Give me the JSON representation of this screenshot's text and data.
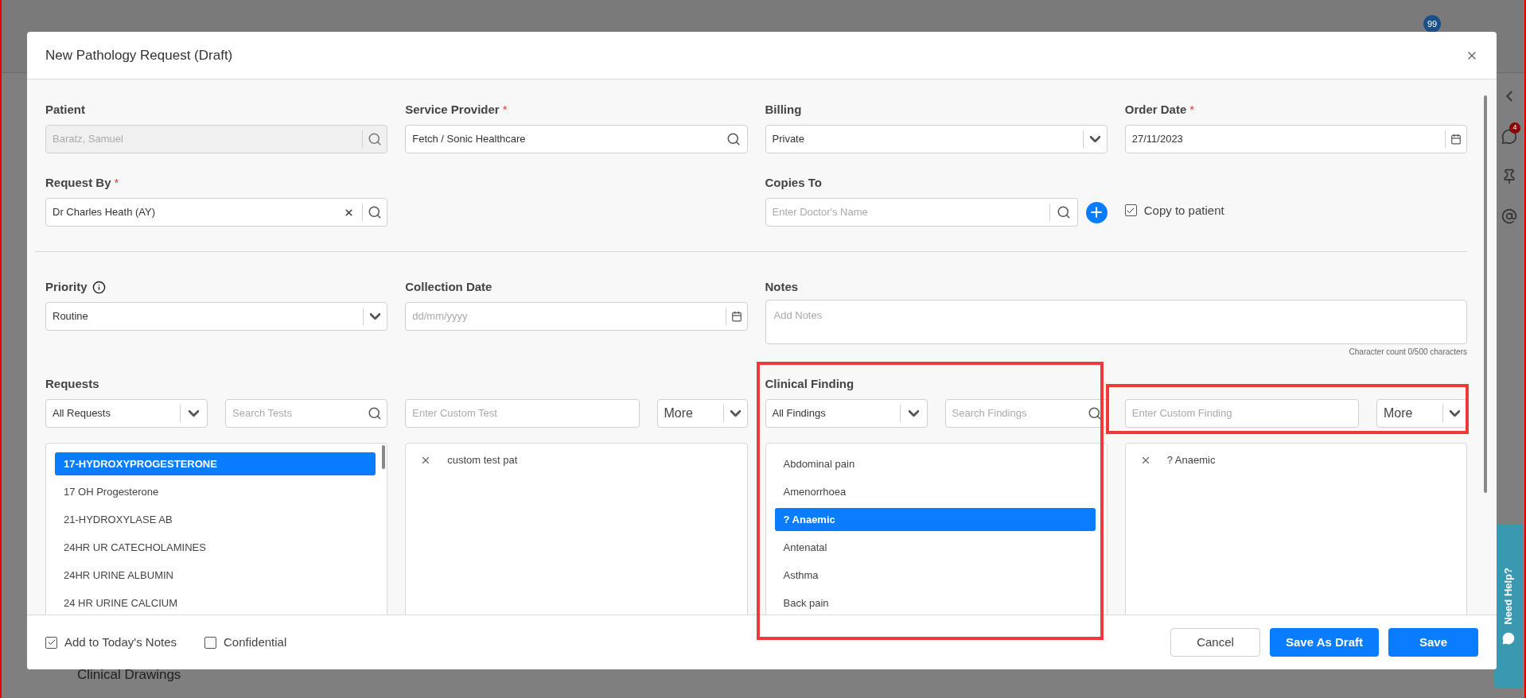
{
  "background": {
    "notification_count": "99",
    "chat_count": "4",
    "sidebar_item": "Clinical Drawings",
    "help_tab": "Need Help?"
  },
  "modal": {
    "title": "New Pathology Request (Draft)"
  },
  "patient": {
    "label": "Patient",
    "value": "Baratz, Samuel",
    "disabled": true
  },
  "service_provider": {
    "label": "Service Provider",
    "required_mark": "*",
    "value": "Fetch / Sonic Healthcare"
  },
  "billing": {
    "label": "Billing",
    "value": "Private"
  },
  "order_date": {
    "label": "Order Date",
    "required_mark": "*",
    "value": "27/11/2023"
  },
  "request_by": {
    "label": "Request By",
    "required_mark": "*",
    "value": "Dr Charles Heath (AY)"
  },
  "copies_to": {
    "label": "Copies To",
    "placeholder": "Enter Doctor's Name"
  },
  "copy_to_patient": {
    "label": "Copy to patient",
    "checked": true
  },
  "priority": {
    "label": "Priority",
    "value": "Routine"
  },
  "collection_date": {
    "label": "Collection Date",
    "placeholder": "dd/mm/yyyy"
  },
  "notes": {
    "label": "Notes",
    "placeholder": "Add Notes",
    "char_count": "Character count 0/500 characters"
  },
  "requests": {
    "label": "Requests",
    "filter": "All Requests",
    "search_placeholder": "Search Tests",
    "custom_placeholder": "Enter Custom Test",
    "more": "More",
    "items": [
      {
        "label": "17-HYDROXYPROGESTERONE",
        "selected": true
      },
      {
        "label": "17 OH Progesterone",
        "selected": false
      },
      {
        "label": "21-HYDROXYLASE AB",
        "selected": false
      },
      {
        "label": "24HR UR CATECHOLAMINES",
        "selected": false
      },
      {
        "label": "24HR URINE ALBUMIN",
        "selected": false
      },
      {
        "label": "24 HR URINE CALCIUM",
        "selected": false
      }
    ],
    "chosen": [
      "custom test pat"
    ]
  },
  "clinical_finding": {
    "label": "Clinical Finding",
    "filter": "All Findings",
    "search_placeholder": "Search Findings",
    "custom_placeholder": "Enter Custom Finding",
    "more": "More",
    "items": [
      {
        "label": "Abdominal pain",
        "selected": false
      },
      {
        "label": "Amenorrhoea",
        "selected": false
      },
      {
        "label": "? Anaemic",
        "selected": true
      },
      {
        "label": "Antenatal",
        "selected": false
      },
      {
        "label": "Asthma",
        "selected": false
      },
      {
        "label": "Back pain",
        "selected": false
      }
    ],
    "chosen": [
      "? Anaemic"
    ]
  },
  "footer": {
    "checks": [
      {
        "label": "Add to Today's Notes",
        "checked": true
      },
      {
        "label": "Confidential",
        "checked": false
      }
    ],
    "buttons": [
      {
        "label": "Cancel",
        "kind": "secondary"
      },
      {
        "label": "Save As Draft",
        "kind": "primary"
      },
      {
        "label": "Save",
        "kind": "primary"
      }
    ]
  }
}
